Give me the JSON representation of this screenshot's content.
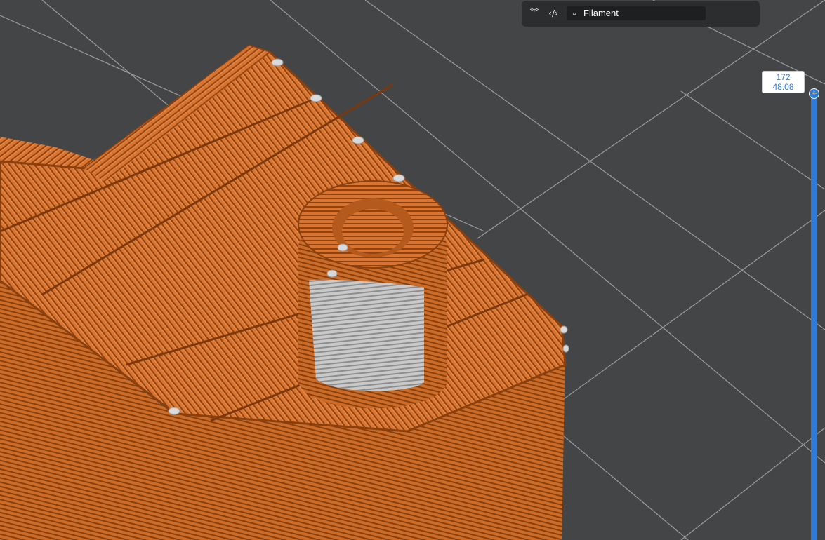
{
  "toolbar": {
    "layers_icon": "double-chevron-down-icon",
    "code_icon": "code-brackets-icon",
    "view_type_value": "Filament"
  },
  "layer_slider": {
    "current_layer": "172",
    "current_height": "48.08"
  },
  "colors": {
    "background": "#434546",
    "grid": "#9a9c9e",
    "filament": "#d8722e",
    "filament_dark": "#9c4810",
    "support_ironing": "#bfbfbf",
    "slider_accent": "#2f7bd6",
    "toolbar_bg": "#2b2d2e"
  }
}
